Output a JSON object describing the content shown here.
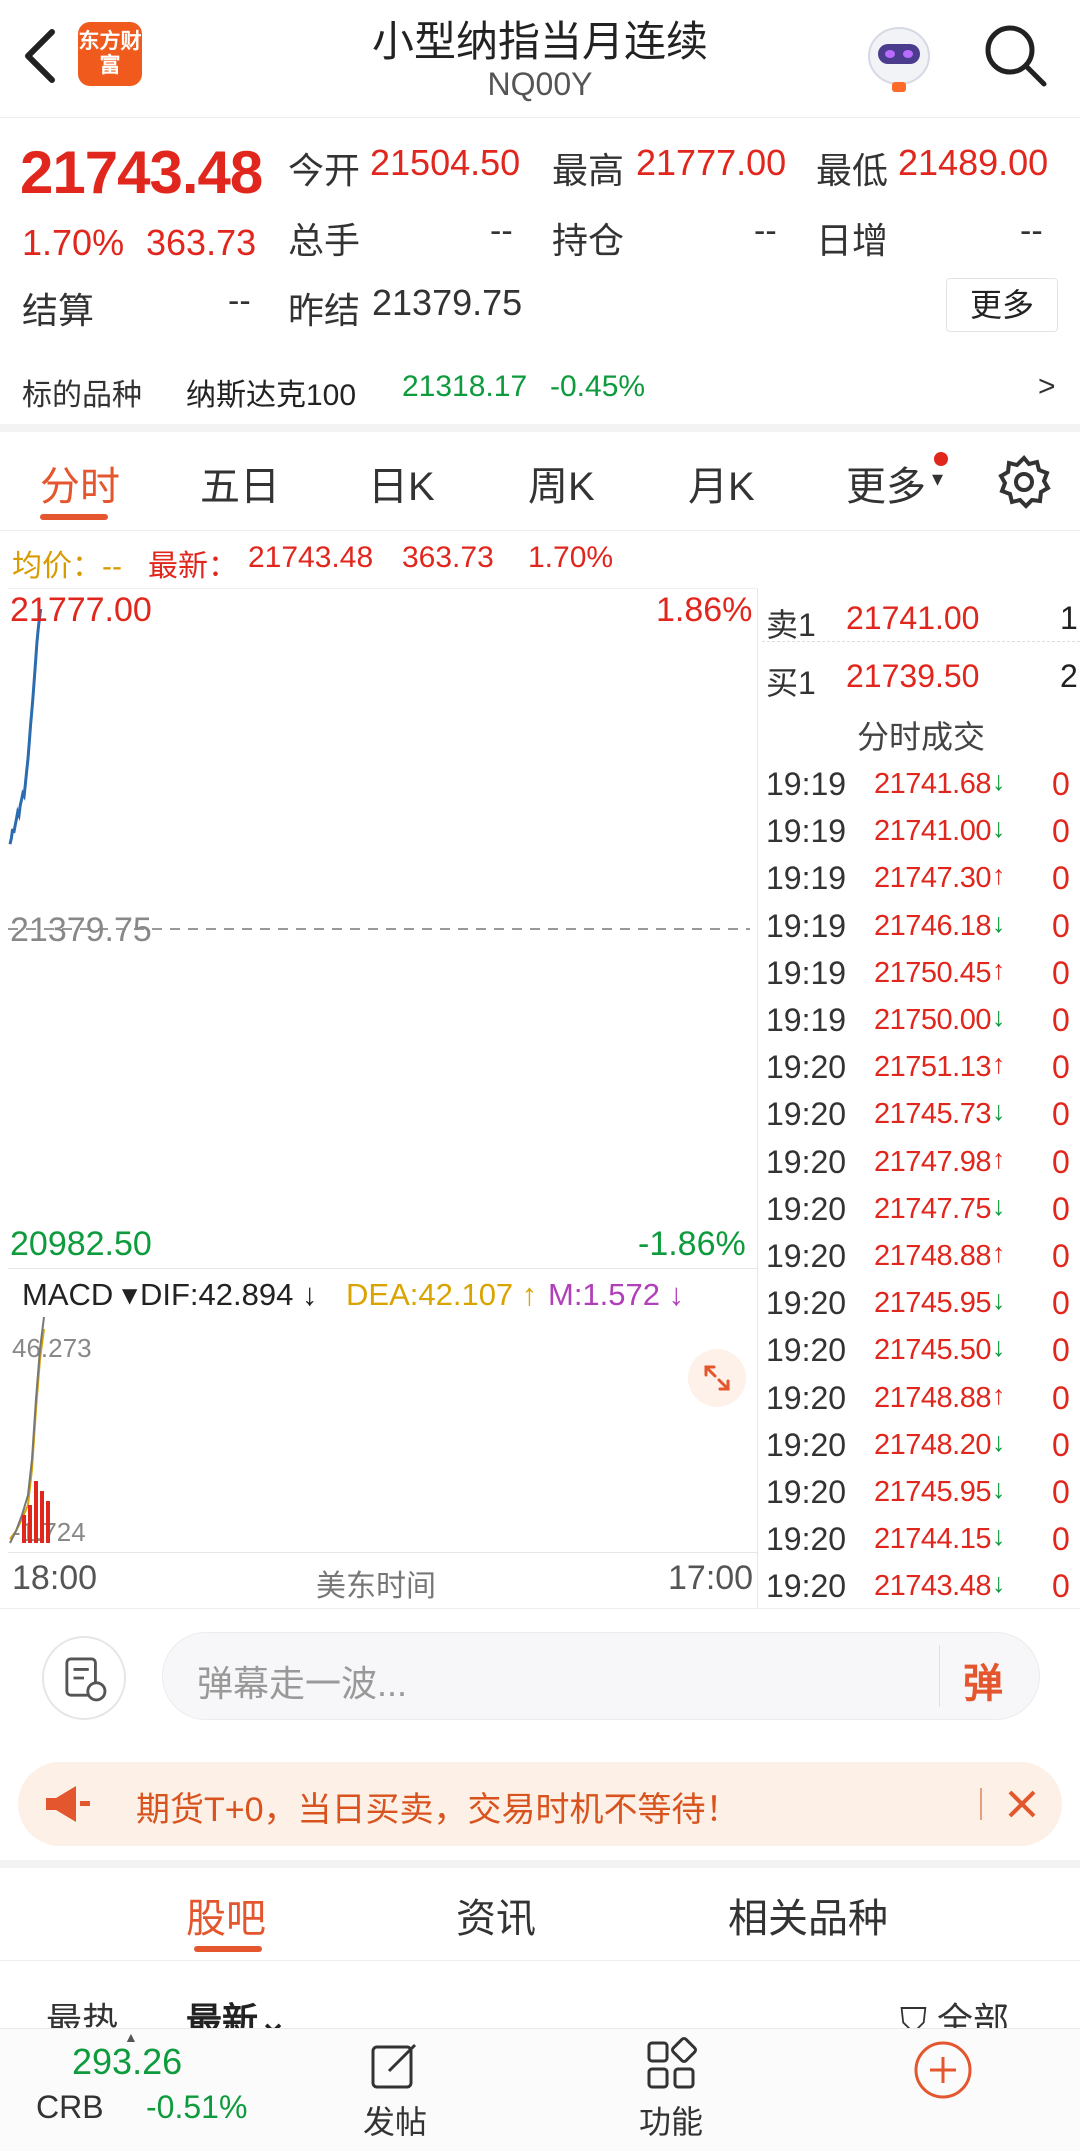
{
  "header": {
    "brand_label": "东方财富",
    "title": "小型纳指当月连续",
    "code": "NQ00Y"
  },
  "quote": {
    "price": "21743.48",
    "change_pct": "1.70%",
    "change_amt": "363.73",
    "open_label": "今开",
    "open_value": "21504.50",
    "high_label": "最高",
    "high_value": "21777.00",
    "low_label": "最低",
    "low_value": "21489.00",
    "volume_label": "总手",
    "volume_value": "--",
    "oi_label": "持仓",
    "oi_value": "--",
    "daily_inc_label": "日增",
    "daily_inc_value": "--",
    "settle_label": "结算",
    "settle_value": "--",
    "prev_settle_label": "昨结",
    "prev_settle_value": "21379.75",
    "more_button": "更多"
  },
  "underlying": {
    "label": "标的品种",
    "name": "纳斯达克100",
    "price": "21318.17",
    "change_pct": "-0.45%",
    "arrow": ">"
  },
  "tabs": {
    "items": [
      "分时",
      "五日",
      "日K",
      "周K",
      "月K",
      "更多"
    ],
    "active_index": 0
  },
  "info_line": {
    "avg_label": "均价：--",
    "latest_label": "最新：",
    "latest_value": "21743.48",
    "latest_change": "363.73",
    "latest_pct": "1.70%"
  },
  "chart": {
    "top_price": "21777.00",
    "top_pct": "1.86%",
    "mid_price": "21379.75",
    "bottom_price": "20982.50",
    "bottom_pct": "-1.86%",
    "colors": {
      "line": "#2b6cb0",
      "up": "#e0261d",
      "down": "#0e9b3d",
      "mid": "#888888"
    }
  },
  "chart_data": {
    "type": "line",
    "y_range": [
      20982.5,
      21777.0
    ],
    "reference": 21379.75,
    "x_range_label": [
      "18:00",
      "17:00"
    ],
    "points": [
      [
        0,
        21485
      ],
      [
        0.2,
        21492
      ],
      [
        0.4,
        21504
      ],
      [
        0.6,
        21499
      ],
      [
        0.8,
        21508
      ],
      [
        1.0,
        21516
      ],
      [
        1.2,
        21525
      ],
      [
        1.4,
        21521
      ],
      [
        1.6,
        21533
      ],
      [
        1.8,
        21540
      ],
      [
        2.0,
        21548
      ],
      [
        2.2,
        21545
      ],
      [
        2.4,
        21560
      ],
      [
        2.6,
        21575
      ],
      [
        2.8,
        21590
      ],
      [
        3.0,
        21610
      ],
      [
        3.2,
        21632
      ],
      [
        3.4,
        21650
      ],
      [
        3.6,
        21668
      ],
      [
        3.8,
        21690
      ],
      [
        4.0,
        21712
      ],
      [
        4.2,
        21735
      ],
      [
        4.4,
        21752
      ],
      [
        4.6,
        21765
      ],
      [
        4.8,
        21777
      ]
    ]
  },
  "macd": {
    "name": "MACD",
    "dif_label": "DIF:42.894",
    "dea_label": "DEA:42.107",
    "m_label": "M:1.572",
    "top_value": "46.273",
    "bottom_value": "-1.724"
  },
  "time_axis": {
    "start": "18:00",
    "middle": "美东时间",
    "end": "17:00"
  },
  "order_book": {
    "sell_label": "卖1",
    "sell_price": "21741.00",
    "sell_vol": "1",
    "buy_label": "买1",
    "buy_price": "21739.50",
    "buy_vol": "2"
  },
  "ticks": {
    "title": "分时成交",
    "rows": [
      {
        "time": "19:19",
        "price": "21741.68",
        "dir": "down",
        "vol": "0"
      },
      {
        "time": "19:19",
        "price": "21741.00",
        "dir": "down",
        "vol": "0"
      },
      {
        "time": "19:19",
        "price": "21747.30",
        "dir": "up",
        "vol": "0"
      },
      {
        "time": "19:19",
        "price": "21746.18",
        "dir": "down",
        "vol": "0"
      },
      {
        "time": "19:19",
        "price": "21750.45",
        "dir": "up",
        "vol": "0"
      },
      {
        "time": "19:19",
        "price": "21750.00",
        "dir": "down",
        "vol": "0"
      },
      {
        "time": "19:20",
        "price": "21751.13",
        "dir": "up",
        "vol": "0"
      },
      {
        "time": "19:20",
        "price": "21745.73",
        "dir": "down",
        "vol": "0"
      },
      {
        "time": "19:20",
        "price": "21747.98",
        "dir": "up",
        "vol": "0"
      },
      {
        "time": "19:20",
        "price": "21747.75",
        "dir": "down",
        "vol": "0"
      },
      {
        "time": "19:20",
        "price": "21748.88",
        "dir": "up",
        "vol": "0"
      },
      {
        "time": "19:20",
        "price": "21745.95",
        "dir": "down",
        "vol": "0"
      },
      {
        "time": "19:20",
        "price": "21745.50",
        "dir": "down",
        "vol": "0"
      },
      {
        "time": "19:20",
        "price": "21748.88",
        "dir": "up",
        "vol": "0"
      },
      {
        "time": "19:20",
        "price": "21748.20",
        "dir": "down",
        "vol": "0"
      },
      {
        "time": "19:20",
        "price": "21745.95",
        "dir": "down",
        "vol": "0"
      },
      {
        "time": "19:20",
        "price": "21744.15",
        "dir": "down",
        "vol": "0"
      },
      {
        "time": "19:20",
        "price": "21743.48",
        "dir": "down",
        "vol": "0"
      }
    ]
  },
  "comment": {
    "placeholder": "弹幕走一波...",
    "danmaku_button": "弹"
  },
  "promo": {
    "text": "期货T+0，当日买卖，交易时机不等待！"
  },
  "bottom_tabs": {
    "items": [
      "股吧",
      "资讯",
      "相关品种"
    ],
    "active_index": 0
  },
  "sort": {
    "hot": "最热",
    "latest": "最新",
    "all": "全部"
  },
  "bottom_bar": {
    "index_price": "293.26",
    "index_code": "CRB",
    "index_pct": "-0.51%",
    "post_label": "发帖",
    "func_label": "功能"
  }
}
